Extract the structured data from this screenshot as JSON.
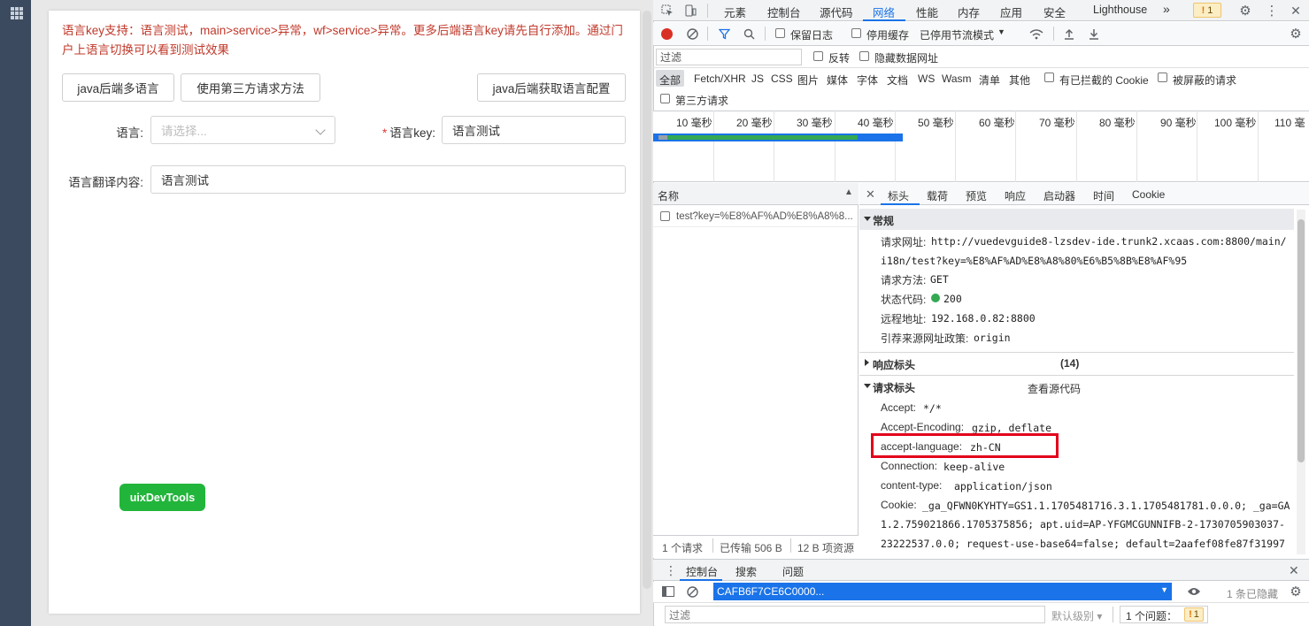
{
  "app": {
    "notice": "语言key支持：语言测试，main>service>异常，wf>service>异常。更多后端语言key请先自行添加。通过门户上语言切换可以看到测试效果",
    "buttons": {
      "java_multi_lang": "java后端多语言",
      "third_party_method": "使用第三方请求方法",
      "java_get_lang_config": "java后端获取语言配置"
    },
    "form": {
      "language_label": "语言:",
      "language_placeholder": "请选择...",
      "key_label": "语言key:",
      "key_required": "*",
      "key_value": "语言测试",
      "translation_label": "语言翻译内容:",
      "translation_value": "语言测试"
    },
    "uix_button": "uixDevTools"
  },
  "devtools": {
    "tabs": [
      "元素",
      "控制台",
      "源代码",
      "网络",
      "性能",
      "内存",
      "应用",
      "安全",
      "Lighthouse"
    ],
    "active_tab": "网络",
    "more_tabs": "»",
    "issues_badge": "1",
    "toolbar": {
      "preserve_log": "保留日志",
      "disable_cache": "停用缓存",
      "throttling": "已停用节流模式"
    },
    "filter": {
      "placeholder": "过滤",
      "invert": "反转",
      "hide_data_urls": "隐藏数据网址"
    },
    "types": [
      "全部",
      "Fetch/XHR",
      "JS",
      "CSS",
      "图片",
      "媒体",
      "字体",
      "文档",
      "WS",
      "Wasm",
      "清单",
      "其他"
    ],
    "blocked_cookies": "有已拦截的 Cookie",
    "blocked_requests": "被屏蔽的请求",
    "third_party": "第三方请求",
    "timeline_labels": [
      "10 毫秒",
      "20 毫秒",
      "30 毫秒",
      "40 毫秒",
      "50 毫秒",
      "60 毫秒",
      "70 毫秒",
      "80 毫秒",
      "90 毫秒",
      "100 毫秒",
      "110 毫"
    ],
    "name_header": "名称",
    "request_name": "test?key=%E8%AF%AD%E8%A8%8...",
    "footer": {
      "requests": "1 个请求",
      "transferred": "已传输 506 B",
      "resources": "12 B 项资源"
    },
    "detail_tabs": [
      "标头",
      "载荷",
      "预览",
      "响应",
      "启动器",
      "时间",
      "Cookie"
    ],
    "general": {
      "title": "常规",
      "url_label": "请求网址:",
      "url_line1": "http://vuedevguide8-lzsdev-ide.trunk2.xcaas.com:8800/main/",
      "url_line2": "i18n/test?key=%E8%AF%AD%E8%A8%80%E6%B5%8B%E8%AF%95",
      "method_label": "请求方法:",
      "method": "GET",
      "status_label": "状态代码:",
      "status": "200",
      "remote_label": "远程地址:",
      "remote": "192.168.0.82:8800",
      "referrer_label": "引荐来源网址政策:",
      "referrer": "origin"
    },
    "response_headers": {
      "title": "响应标头",
      "count": "(14)"
    },
    "request_headers": {
      "title": "请求标头",
      "view_source": "查看源代码",
      "accept_label": "Accept:",
      "accept": "*/*",
      "encoding_label": "Accept-Encoding:",
      "encoding": "gzip, deflate",
      "lang_label": "accept-language:",
      "lang": "zh-CN",
      "connection_label": "Connection:",
      "connection": "keep-alive",
      "ctype_label": "content-type:",
      "ctype": "application/json",
      "cookie_label": "Cookie:",
      "cookie_line1": "_ga_QFWN0KYHTY=GS1.1.1705481716.3.1.1705481781.0.0.0; _ga=GA",
      "cookie_line2": "1.2.759021866.1705375856; apt.uid=AP-YFGMCGUNNIFB-2-1730705903037-",
      "cookie_line3": "23222537.0.0; request-use-base64=false; default=2aafef08fe87f31997"
    },
    "drawer": {
      "tabs": [
        "控制台",
        "搜索",
        "问题"
      ],
      "context": "CAFB6F7CE6C0000...",
      "hidden": "1 条已隐藏",
      "filter_placeholder": "过滤",
      "level": "默认级别 ▾",
      "issues_label": "1 个问题：",
      "issues_count": "1"
    },
    "colors": {
      "accent": "#1a73e8",
      "record": "#d93025",
      "highlight": "#e3001b",
      "success": "#34a853"
    }
  }
}
